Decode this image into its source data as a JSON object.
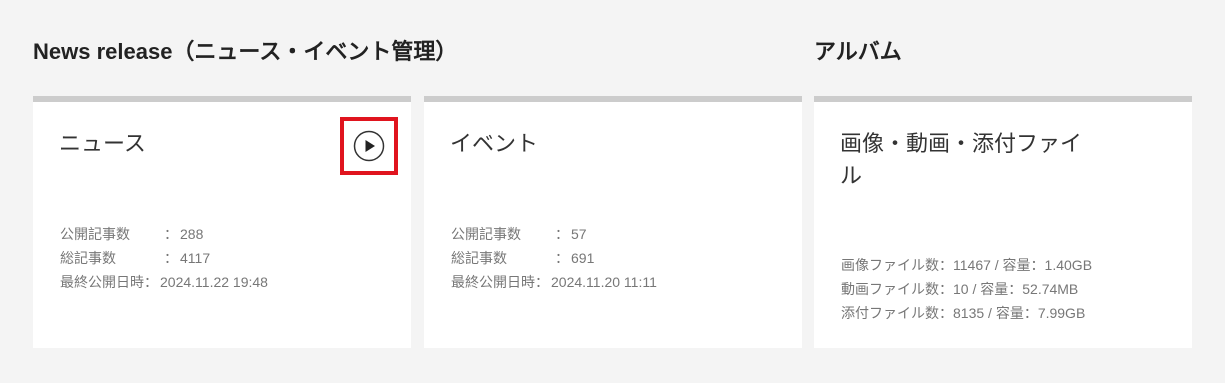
{
  "sections": {
    "news_title": "News release（ニュース・イベント管理）",
    "album_title": "アルバム"
  },
  "news_card": {
    "title": "ニュース",
    "published_label": "公開記事数",
    "published_value": "288",
    "total_label": "総記事数",
    "total_value": "4117",
    "updated_label": "最終公開日時",
    "updated_value": "2024.11.22 19:48",
    "action_icon": "play-circle-icon"
  },
  "event_card": {
    "title": "イベント",
    "published_label": "公開記事数",
    "published_value": "57",
    "total_label": "総記事数",
    "total_value": "691",
    "updated_label": "最終公開日時",
    "updated_value": "2024.11.20 11:11"
  },
  "album_card": {
    "title": "画像・動画・添付ファイル",
    "image_stats": "画像ファイル数：11467 / 容量：1.40GB",
    "video_stats": "動画ファイル数：10 / 容量：52.74MB",
    "attachment_stats": "添付ファイル数：8135 / 容量：7.99GB"
  },
  "colors": {
    "background": "#f4f4f4",
    "card": "#ffffff",
    "card_top_bar": "#cccccc",
    "highlight_border": "#e0141e",
    "stat_text": "#777777"
  }
}
